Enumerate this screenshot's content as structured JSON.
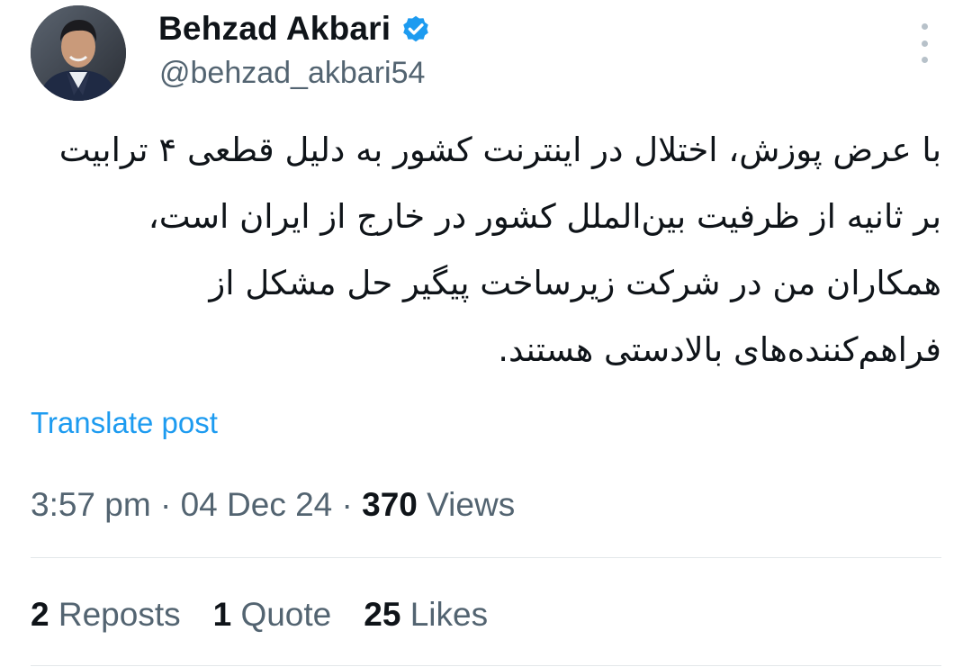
{
  "author": {
    "display_name": "Behzad Akbari",
    "handle": "@behzad_akbari54",
    "verified_color": "#1d9bf0"
  },
  "tweet": {
    "text": "با عرض پوزش، اختلال در اینترنت کشور به دلیل قطعی ۴ ترابیت بر ثانیه از ظرفیت بین‌الملل کشور در خارج از ایران است، همکاران من در شرکت زیرساخت پیگیر حل مشکل از فراهم‌کننده‌های بالادستی هستند.",
    "translate_label": "Translate post"
  },
  "meta": {
    "time": "3:57 pm",
    "date": "04 Dec 24",
    "views_count": "370",
    "views_label": "Views"
  },
  "stats": {
    "reposts_count": "2",
    "reposts_label": "Reposts",
    "quotes_count": "1",
    "quotes_label": "Quote",
    "likes_count": "25",
    "likes_label": "Likes"
  },
  "icons": {
    "more": "more-vertical-icon",
    "verified": "verified-badge-icon"
  }
}
